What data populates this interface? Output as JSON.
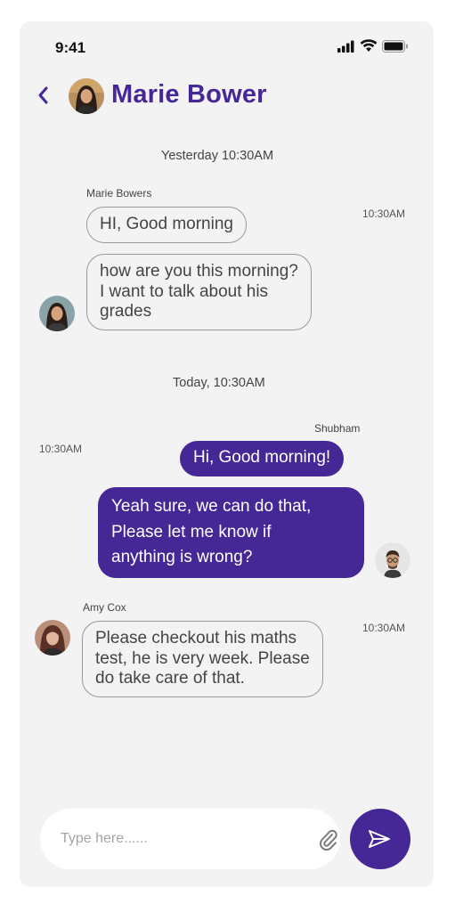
{
  "status_bar": {
    "time": "9:41",
    "icons": [
      "signal-icon",
      "wifi-icon",
      "battery-icon"
    ]
  },
  "header": {
    "back_icon": "chevron-left-icon",
    "title": "Marie Bower",
    "avatar": "marie-avatar"
  },
  "conversation": {
    "separators": [
      "Yesterday 10:30AM",
      "Today, 10:30AM"
    ],
    "groups": [
      {
        "sender": "Marie Bowers",
        "time": "10:30AM",
        "messages": [
          [
            "HI, Good morning"
          ],
          [
            "how are you this morning?",
            "I want to talk about his",
            "grades"
          ]
        ]
      },
      {
        "sender": "Shubham",
        "time": "10:30AM",
        "messages": [
          [
            "Hi, Good morning!"
          ],
          [
            "Yeah sure, we can do that,",
            "Please let me know if",
            "anything is wrong?"
          ]
        ]
      },
      {
        "sender": "Amy Cox",
        "time": "10:30AM",
        "messages": [
          [
            "Please checkout his maths",
            "test, he is very week. Please",
            "do take care of that."
          ]
        ]
      }
    ]
  },
  "composer": {
    "placeholder": "Type here......",
    "value": "",
    "attach_icon": "paperclip-icon",
    "send_icon": "send-icon"
  },
  "colors": {
    "accent": "#452796",
    "background": "#f3f3f3",
    "bubble_border": "#9a9a9a",
    "text": "#444444"
  }
}
